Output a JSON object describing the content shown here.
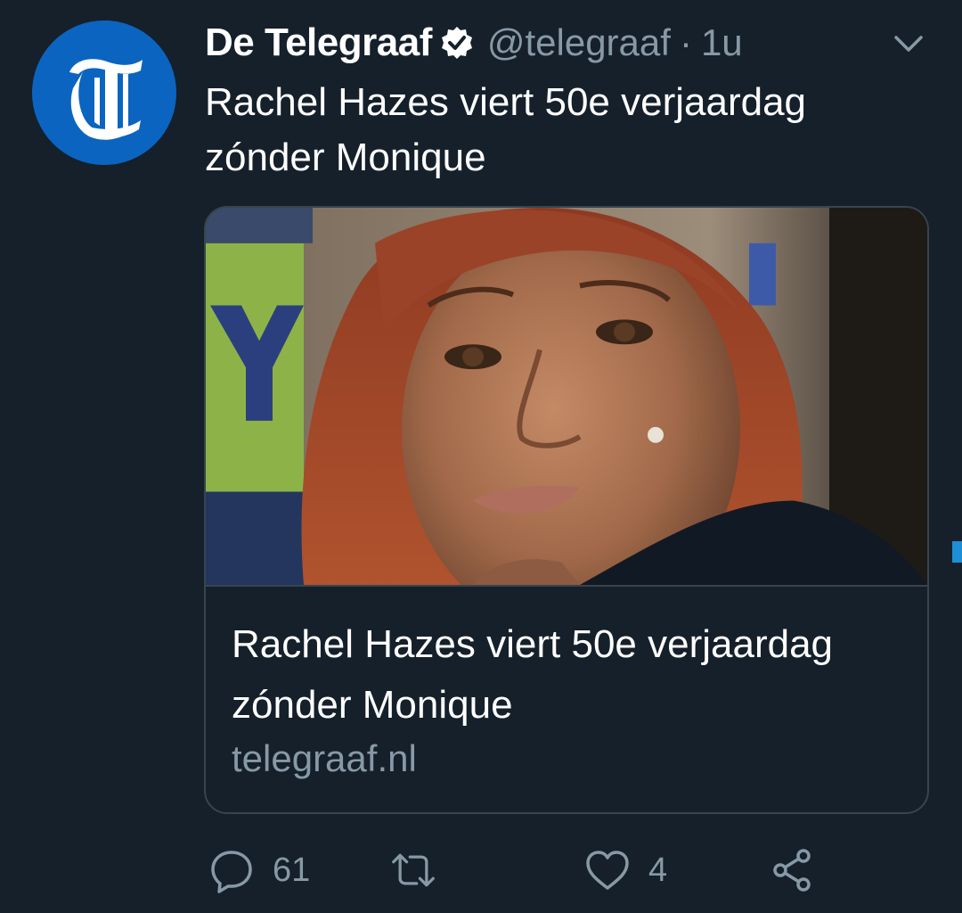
{
  "tweet": {
    "author": {
      "display_name": "De Telegraaf",
      "verified": true,
      "handle": "@telegraaf",
      "separator": "·",
      "time": "1u",
      "avatar_letter": "T"
    },
    "text": "Rachel Hazes viert 50e verjaardag zónder Monique",
    "card": {
      "image": "portrait-photo",
      "title": "Rachel Hazes viert 50e verjaardag zónder Monique",
      "domain": "telegraaf.nl"
    },
    "actions": {
      "reply_count": "61",
      "retweet_count": "",
      "like_count": "4"
    }
  },
  "colors": {
    "background": "#15202b",
    "text": "#ffffff",
    "muted": "#8899a6",
    "border": "#38444d",
    "avatar_blue": "#0b64c0",
    "accent": "#1d8fd6"
  },
  "icons": {
    "verified": "verified-badge-icon",
    "caret": "chevron-down-icon",
    "reply": "reply-icon",
    "retweet": "retweet-icon",
    "like": "heart-icon",
    "share": "share-icon"
  }
}
